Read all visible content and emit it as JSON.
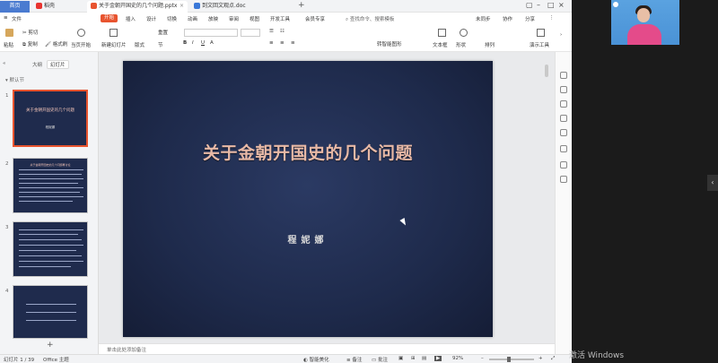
{
  "tabs": {
    "home": "首页",
    "wps": "稻壳",
    "ppt": "关于金朝开国史的几个问题.pptx",
    "doc": "到文回文观点.doc"
  },
  "menu": {
    "file": "文件",
    "items": [
      "开始",
      "插入",
      "设计",
      "切换",
      "动画",
      "放映",
      "审阅",
      "视图",
      "开发工具",
      "会员专享"
    ],
    "search": "查找命令、搜索模板",
    "right": [
      "未同步",
      "协作",
      "分享"
    ]
  },
  "ribbon": {
    "paste": "粘贴",
    "cut": "剪切",
    "copy": "复制",
    "format_painter": "格式刷",
    "from_current": "当页开始",
    "new_slide": "新建幻灯片",
    "layout": "版式",
    "section": "节",
    "reset": "重置",
    "text_box": "文本框",
    "shape": "形状",
    "arrange": "排列",
    "presenter": "演示工具",
    "smart_graphic": "转智能图形"
  },
  "left_panel": {
    "tab_outline": "大纲",
    "tab_slides": "幻灯片",
    "section_label": "默认节",
    "thumb1_title": "关于金朝开国史的几个问题",
    "thumb1_author": "程妮娜",
    "thumb2_title": "关于金朝开国史的几个问题再讨论",
    "add": "+"
  },
  "slide": {
    "title": "关于金朝开国史的几个问题",
    "author": "程妮娜"
  },
  "notes_placeholder": "单击此处添加备注",
  "status": {
    "slide_count": "幻灯片 1 / 39",
    "theme": "Office 主题",
    "beautify": "智能美化",
    "notes": "备注",
    "comments": "批注",
    "zoom": "92%"
  },
  "watermark": "激活 Windows",
  "colors": {
    "accent": "#e8542f",
    "slide_bg": "#1e2a4b",
    "title_color": "#e8b9a6"
  }
}
